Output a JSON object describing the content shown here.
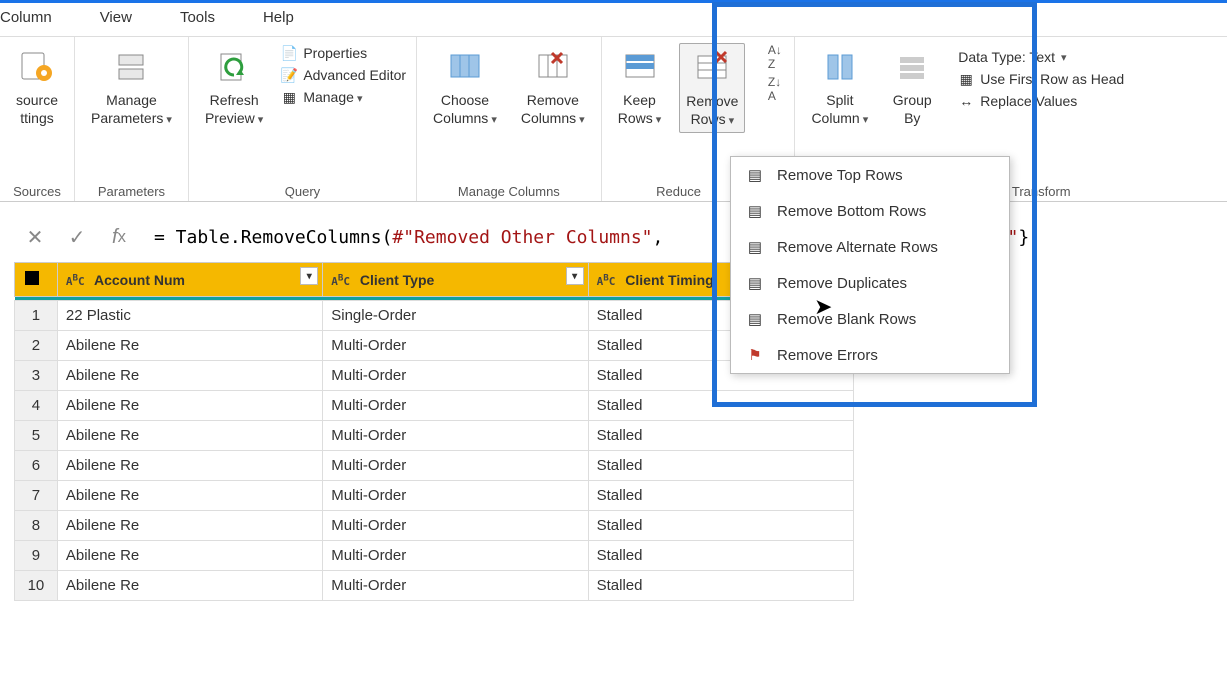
{
  "menu": [
    "Column",
    "View",
    "Tools",
    "Help"
  ],
  "ribbon": {
    "groups": {
      "sources": {
        "label": "Sources",
        "btn": {
          "line1": "source",
          "line2": "ttings"
        }
      },
      "parameters": {
        "label": "Parameters",
        "btn": "Manage\nParameters"
      },
      "query": {
        "label": "Query",
        "refresh": "Refresh\nPreview",
        "properties": "Properties",
        "advanced": "Advanced Editor",
        "manage": "Manage"
      },
      "manage_columns": {
        "label": "Manage Columns",
        "choose": "Choose\nColumns",
        "remove": "Remove\nColumns"
      },
      "reduce": {
        "label": "Reduce",
        "keep": "Keep\nRows",
        "removerows": "Remove\nRows"
      },
      "sort": {
        "label": ""
      },
      "split": "Split\nColumn",
      "groupby": "Group\nBy",
      "transform": {
        "label": "Transform",
        "dtype": "Data Type: Text",
        "firstrow": "Use First Row as Head",
        "replace": "Replace Values"
      }
    }
  },
  "dropdown": [
    {
      "icon": "rows-top",
      "label": "Remove Top Rows"
    },
    {
      "icon": "rows-bottom",
      "label": "Remove Bottom Rows"
    },
    {
      "icon": "rows-alt",
      "label": "Remove Alternate Rows"
    },
    {
      "icon": "rows-dup",
      "label": "Remove Duplicates"
    },
    {
      "icon": "rows-blank",
      "label": "Remove Blank Rows"
    },
    {
      "icon": "rows-err",
      "label": "Remove Errors"
    }
  ],
  "formula": {
    "prefix": "= Table.RemoveColumns(",
    "str1": "#\"Removed Other Columns\"",
    "mid": ",",
    "str2_tail": "ity\"",
    "suffix": "})"
  },
  "table": {
    "columns": [
      {
        "type": "ABC",
        "name": "Account Num"
      },
      {
        "type": "ABC",
        "name": "Client Type"
      },
      {
        "type": "ABC",
        "name": "Client Timing"
      }
    ],
    "rows": [
      {
        "r": 1,
        "c1": "22 Plastic",
        "c2": "Single-Order",
        "c3": "Stalled"
      },
      {
        "r": 2,
        "c1": "Abilene Re",
        "c2": "Multi-Order",
        "c3": "Stalled"
      },
      {
        "r": 3,
        "c1": "Abilene Re",
        "c2": "Multi-Order",
        "c3": "Stalled"
      },
      {
        "r": 4,
        "c1": "Abilene Re",
        "c2": "Multi-Order",
        "c3": "Stalled"
      },
      {
        "r": 5,
        "c1": "Abilene Re",
        "c2": "Multi-Order",
        "c3": "Stalled"
      },
      {
        "r": 6,
        "c1": "Abilene Re",
        "c2": "Multi-Order",
        "c3": "Stalled"
      },
      {
        "r": 7,
        "c1": "Abilene Re",
        "c2": "Multi-Order",
        "c3": "Stalled"
      },
      {
        "r": 8,
        "c1": "Abilene Re",
        "c2": "Multi-Order",
        "c3": "Stalled"
      },
      {
        "r": 9,
        "c1": "Abilene Re",
        "c2": "Multi-Order",
        "c3": "Stalled"
      },
      {
        "r": 10,
        "c1": "Abilene Re",
        "c2": "Multi-Order",
        "c3": "Stalled"
      }
    ]
  }
}
